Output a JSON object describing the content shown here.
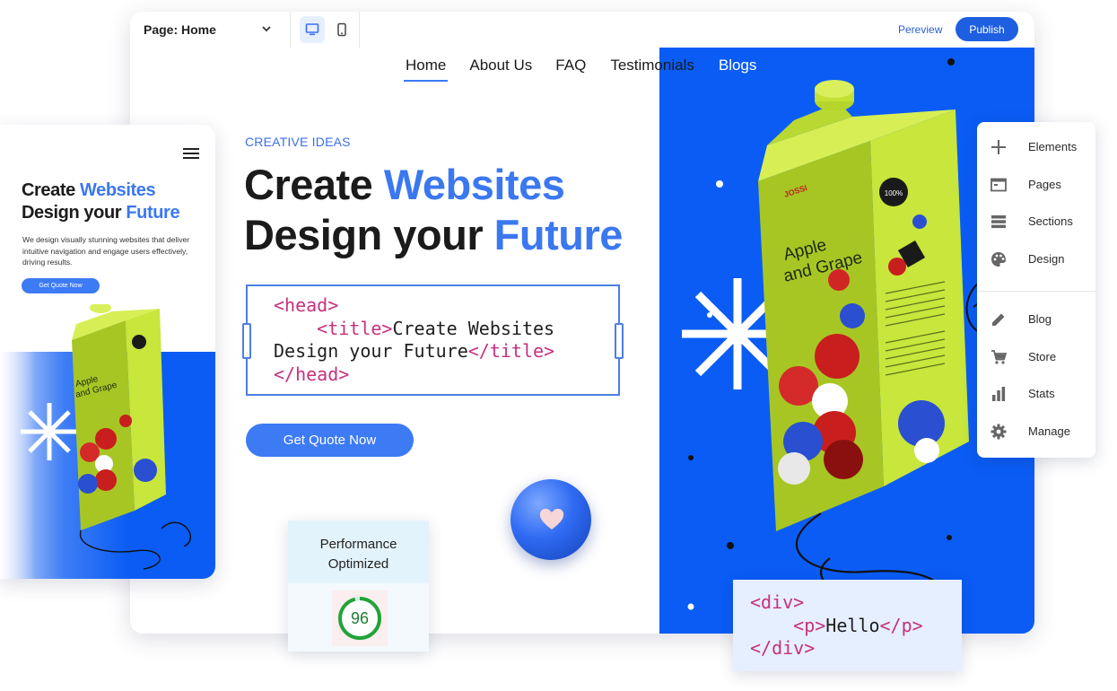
{
  "topbar": {
    "page_select": "Page: Home",
    "preview_label": "Pereview",
    "publish_label": "Publish"
  },
  "nav": {
    "items": [
      "Home",
      "About Us",
      "FAQ",
      "Testimonials",
      "Blogs"
    ],
    "active": "Home"
  },
  "hero": {
    "eyebrow": "CREATIVE IDEAS",
    "line1_a": "Create ",
    "line1_b": "Websites",
    "line2_a": "Design your ",
    "line2_b": "Future",
    "cta": "Get Quote Now"
  },
  "code_head": {
    "l1_tag": "<head>",
    "l2_indent": "    ",
    "l2_open": "<title>",
    "l2_text": "Create Websites",
    "l3_text": "Design your Future",
    "l3_close": "</title>",
    "l4_tag": "</head>"
  },
  "mobile": {
    "line1_a": "Create ",
    "line1_b": "Websites",
    "line2_a": "Design your ",
    "line2_b": "Future",
    "paragraph": "We design visually stunning websites that deliver intuitive navigation and engage users effectively, driving results.",
    "cta": "Get Quote Now"
  },
  "side_panel": {
    "items": [
      "Elements",
      "Pages",
      "Sections",
      "Design",
      "Blog",
      "Store",
      "Stats",
      "Manage"
    ]
  },
  "performance": {
    "title": "Performance Optimized",
    "score": "96"
  },
  "code_div": {
    "l1": "<div>",
    "l2_indent": "    ",
    "l2_open": "<p>",
    "l2_text": "Hello",
    "l2_close": "</p>",
    "l3": "</div>"
  },
  "product": {
    "brand": "JOSSI",
    "name_line1": "Apple",
    "name_line2": "and Grape",
    "badge": "100%"
  },
  "colors": {
    "brand_blue": "#0a5cf5",
    "accent_blue": "#3b78f0",
    "tag_pink": "#c7317c",
    "carton_green": "#c8e63b",
    "score_green": "#1e7c30"
  },
  "icons": [
    "chevron-down-icon",
    "desktop-icon",
    "mobile-icon",
    "menu-icon",
    "plus-icon",
    "pages-icon",
    "sections-icon",
    "palette-icon",
    "pencil-icon",
    "cart-icon",
    "bar-chart-icon",
    "gear-icon",
    "heart-icon"
  ]
}
